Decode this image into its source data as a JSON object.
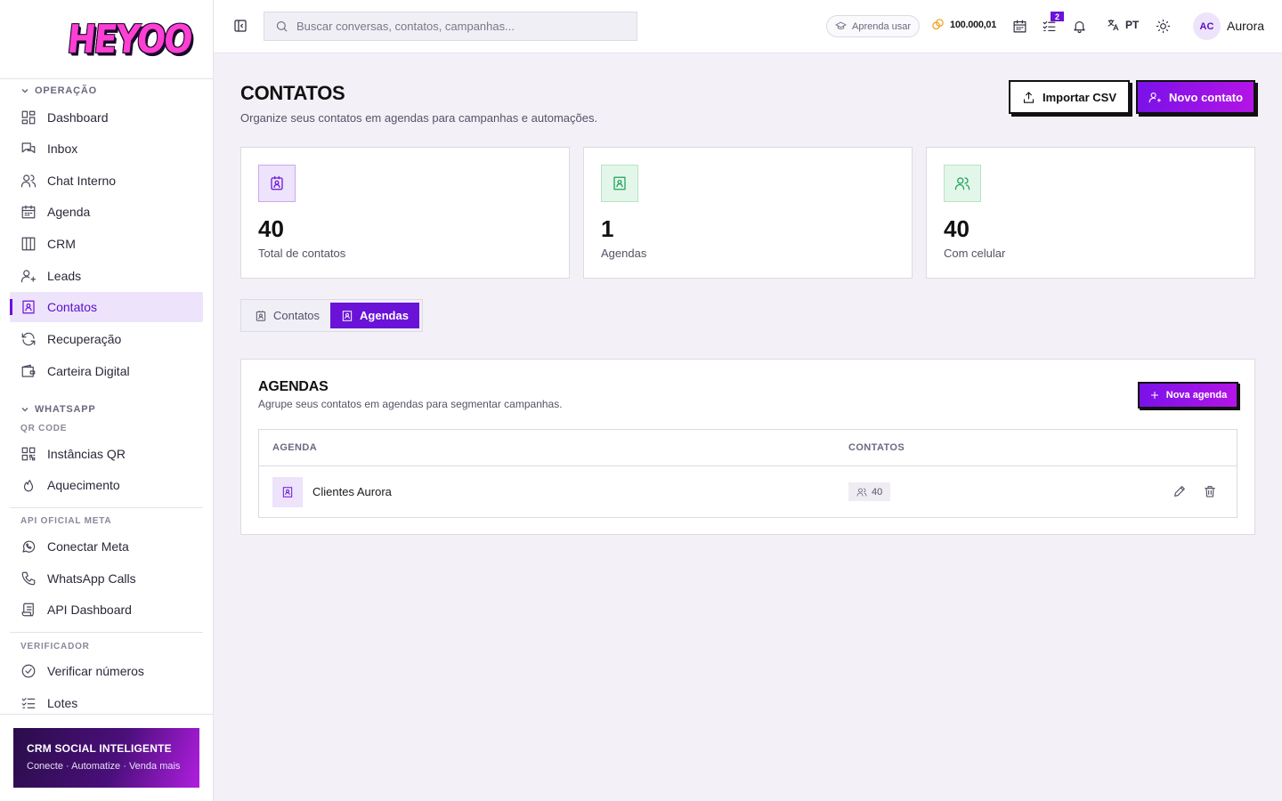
{
  "brand": {
    "logo_text": "HEYOO"
  },
  "sidebar": {
    "groups": {
      "operacao": "OPERAÇÃO",
      "whatsapp": "WHATSAPP",
      "qr_code": "QR CODE",
      "api_oficial": "API OFICIAL META",
      "verificador": "VERIFICADOR"
    },
    "items": [
      {
        "label": "Dashboard",
        "icon": "grid-icon"
      },
      {
        "label": "Inbox",
        "icon": "chat-bubbles-icon"
      },
      {
        "label": "Chat Interno",
        "icon": "users-icon"
      },
      {
        "label": "Agenda",
        "icon": "calendar-icon"
      },
      {
        "label": "CRM",
        "icon": "columns-icon"
      },
      {
        "label": "Leads",
        "icon": "user-plus-icon"
      },
      {
        "label": "Contatos",
        "icon": "contact-book-icon",
        "active": true
      },
      {
        "label": "Recuperação",
        "icon": "refresh-icon"
      },
      {
        "label": "Carteira Digital",
        "icon": "wallet-icon"
      },
      {
        "label": "Instâncias QR",
        "icon": "qr-icon"
      },
      {
        "label": "Aquecimento",
        "icon": "flame-icon"
      },
      {
        "label": "Conectar Meta",
        "icon": "whatsapp-icon"
      },
      {
        "label": "WhatsApp Calls",
        "icon": "phone-icon"
      },
      {
        "label": "API Dashboard",
        "icon": "scroll-icon"
      },
      {
        "label": "Verificar números",
        "icon": "check-circle-icon"
      },
      {
        "label": "Lotes",
        "icon": "list-check-icon"
      }
    ],
    "promo": {
      "title": "CRM SOCIAL INTELIGENTE",
      "subtitle": "Conecte · Automatize · Venda mais"
    }
  },
  "topbar": {
    "search_placeholder": "Buscar conversas, contatos, campanhas...",
    "learn_label": "Aprenda usar",
    "credits": "100.000,01",
    "tasks_badge": "2",
    "language": "PT",
    "avatar_initials": "AC",
    "user_name": "Aurora"
  },
  "page": {
    "title": "CONTATOS",
    "subtitle": "Organize seus contatos em agendas para campanhas e automações.",
    "import_label": "Importar CSV",
    "new_contact_label": "Novo contato"
  },
  "stats": [
    {
      "value": "40",
      "label": "Total de contatos",
      "icon": "contact-badge-icon",
      "color": "#6a12d8",
      "bg": "#ede3fb"
    },
    {
      "value": "1",
      "label": "Agendas",
      "icon": "contact-book-icon",
      "color": "#1fa35a",
      "bg": "#e3f6ea"
    },
    {
      "value": "40",
      "label": "Com celular",
      "icon": "users-icon",
      "color": "#1fa35a",
      "bg": "#e3f6ea"
    }
  ],
  "tabs": [
    {
      "label": "Contatos",
      "active": false
    },
    {
      "label": "Agendas",
      "active": true
    }
  ],
  "agendas": {
    "title": "AGENDAS",
    "subtitle": "Agrupe seus contatos em agendas para segmentar campanhas.",
    "new_label": "Nova agenda",
    "columns": [
      "AGENDA",
      "CONTATOS"
    ],
    "rows": [
      {
        "name": "Clientes Aurora",
        "count": "40"
      }
    ]
  }
}
